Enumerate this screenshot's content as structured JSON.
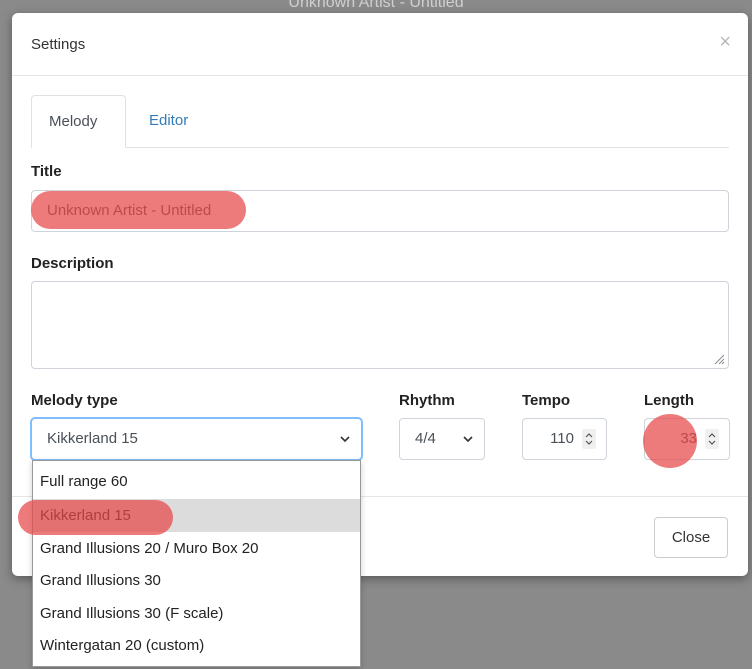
{
  "background_title": "Unknown Artist - Untitled",
  "modal": {
    "title": "Settings",
    "close_symbol": "×",
    "tabs": [
      {
        "label": "Melody",
        "active": true
      },
      {
        "label": "Editor",
        "active": false
      }
    ],
    "title_field": {
      "label": "Title",
      "value": "Unknown Artist - Untitled"
    },
    "description_field": {
      "label": "Description",
      "value": ""
    },
    "melody_type": {
      "label": "Melody type",
      "selected": "Kikkerland 15",
      "options": [
        "Full range 60",
        "Kikkerland 15",
        "Grand Illusions 20 / Muro Box 20",
        "Grand Illusions 30",
        "Grand Illusions 30 (F scale)",
        "Wintergatan 20 (custom)"
      ]
    },
    "rhythm": {
      "label": "Rhythm",
      "selected": "4/4"
    },
    "tempo": {
      "label": "Tempo",
      "value": "110"
    },
    "length": {
      "label": "Length",
      "value": "33"
    },
    "footer": {
      "close_label": "Close"
    }
  },
  "colors": {
    "highlight": "#e84848",
    "link": "#337ab7",
    "selected_option_bg": "#dcdcdc"
  }
}
